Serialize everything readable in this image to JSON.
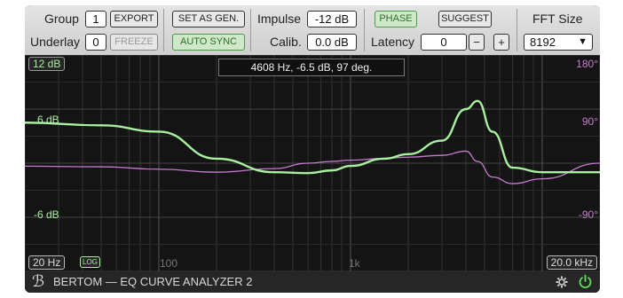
{
  "toolbar": {
    "group_label": "Group",
    "group_value": "1",
    "export_label": "EXPORT",
    "underlay_label": "Underlay",
    "underlay_value": "0",
    "freeze_label": "FREEZE",
    "set_as_gen_label": "SET AS GEN.",
    "auto_sync_label": "AUTO SYNC",
    "impulse_label": "Impulse",
    "impulse_value": "-12 dB",
    "calib_label": "Calib.",
    "calib_value": "0.0 dB",
    "phase_label": "PHASE",
    "suggest_label": "SUGGEST",
    "latency_label": "Latency",
    "latency_value": "0",
    "latency_minus": "−",
    "latency_plus": "+",
    "fft_label": "FFT Size",
    "fft_value": "8192",
    "fft_arrow": "▼"
  },
  "graph": {
    "readout": "4608 Hz, -6.5 dB, 97 deg.",
    "db_top": "12 dB",
    "db_mid": "6 dB",
    "db_low": "-6 dB",
    "deg_top": "180°",
    "deg_mid": "90°",
    "deg_low": "-90°",
    "freq_left": "20 Hz",
    "log_label": "LOG",
    "freq_100": "100",
    "freq_1k": "1k",
    "freq_right": "20.0 kHz"
  },
  "footer": {
    "title": "BERTOM — EQ CURVE ANALYZER 2",
    "logo_glyph": "ℬ",
    "settings_icon": "gear-icon",
    "power_icon": "power-icon"
  },
  "colors": {
    "magnitude": "#a8f0a0",
    "phase": "#c77ad0",
    "accent_green": "#4b9a4b"
  },
  "chart_data": {
    "type": "line",
    "xscale": "log",
    "xlim": [
      20,
      20000
    ],
    "ylim_db": [
      -12,
      12
    ],
    "ylim_deg": [
      -180,
      180
    ],
    "series": [
      {
        "x": [
          20,
          50,
          100,
          200,
          400,
          600,
          800,
          1000,
          1500,
          2000,
          3000,
          4000,
          4600,
          5500,
          7000,
          10000,
          20000
        ],
        "values": [
          4.5,
          4.2,
          3.5,
          0.5,
          -1.0,
          -1.1,
          -0.8,
          -0.3,
          0.5,
          1.0,
          2.5,
          6.0,
          6.9,
          3.5,
          -0.5,
          -1.0,
          -1.0
        ]
      },
      {
        "x": [
          20,
          50,
          100,
          200,
          400,
          600,
          800,
          1000,
          1500,
          2000,
          3000,
          4000,
          4600,
          5500,
          7000,
          10000,
          20000
        ],
        "values": [
          -5,
          -6,
          -10,
          -15,
          -9,
          0,
          3,
          5,
          8,
          10,
          13,
          20,
          3,
          -23,
          -34,
          -26,
          0
        ]
      }
    ]
  }
}
